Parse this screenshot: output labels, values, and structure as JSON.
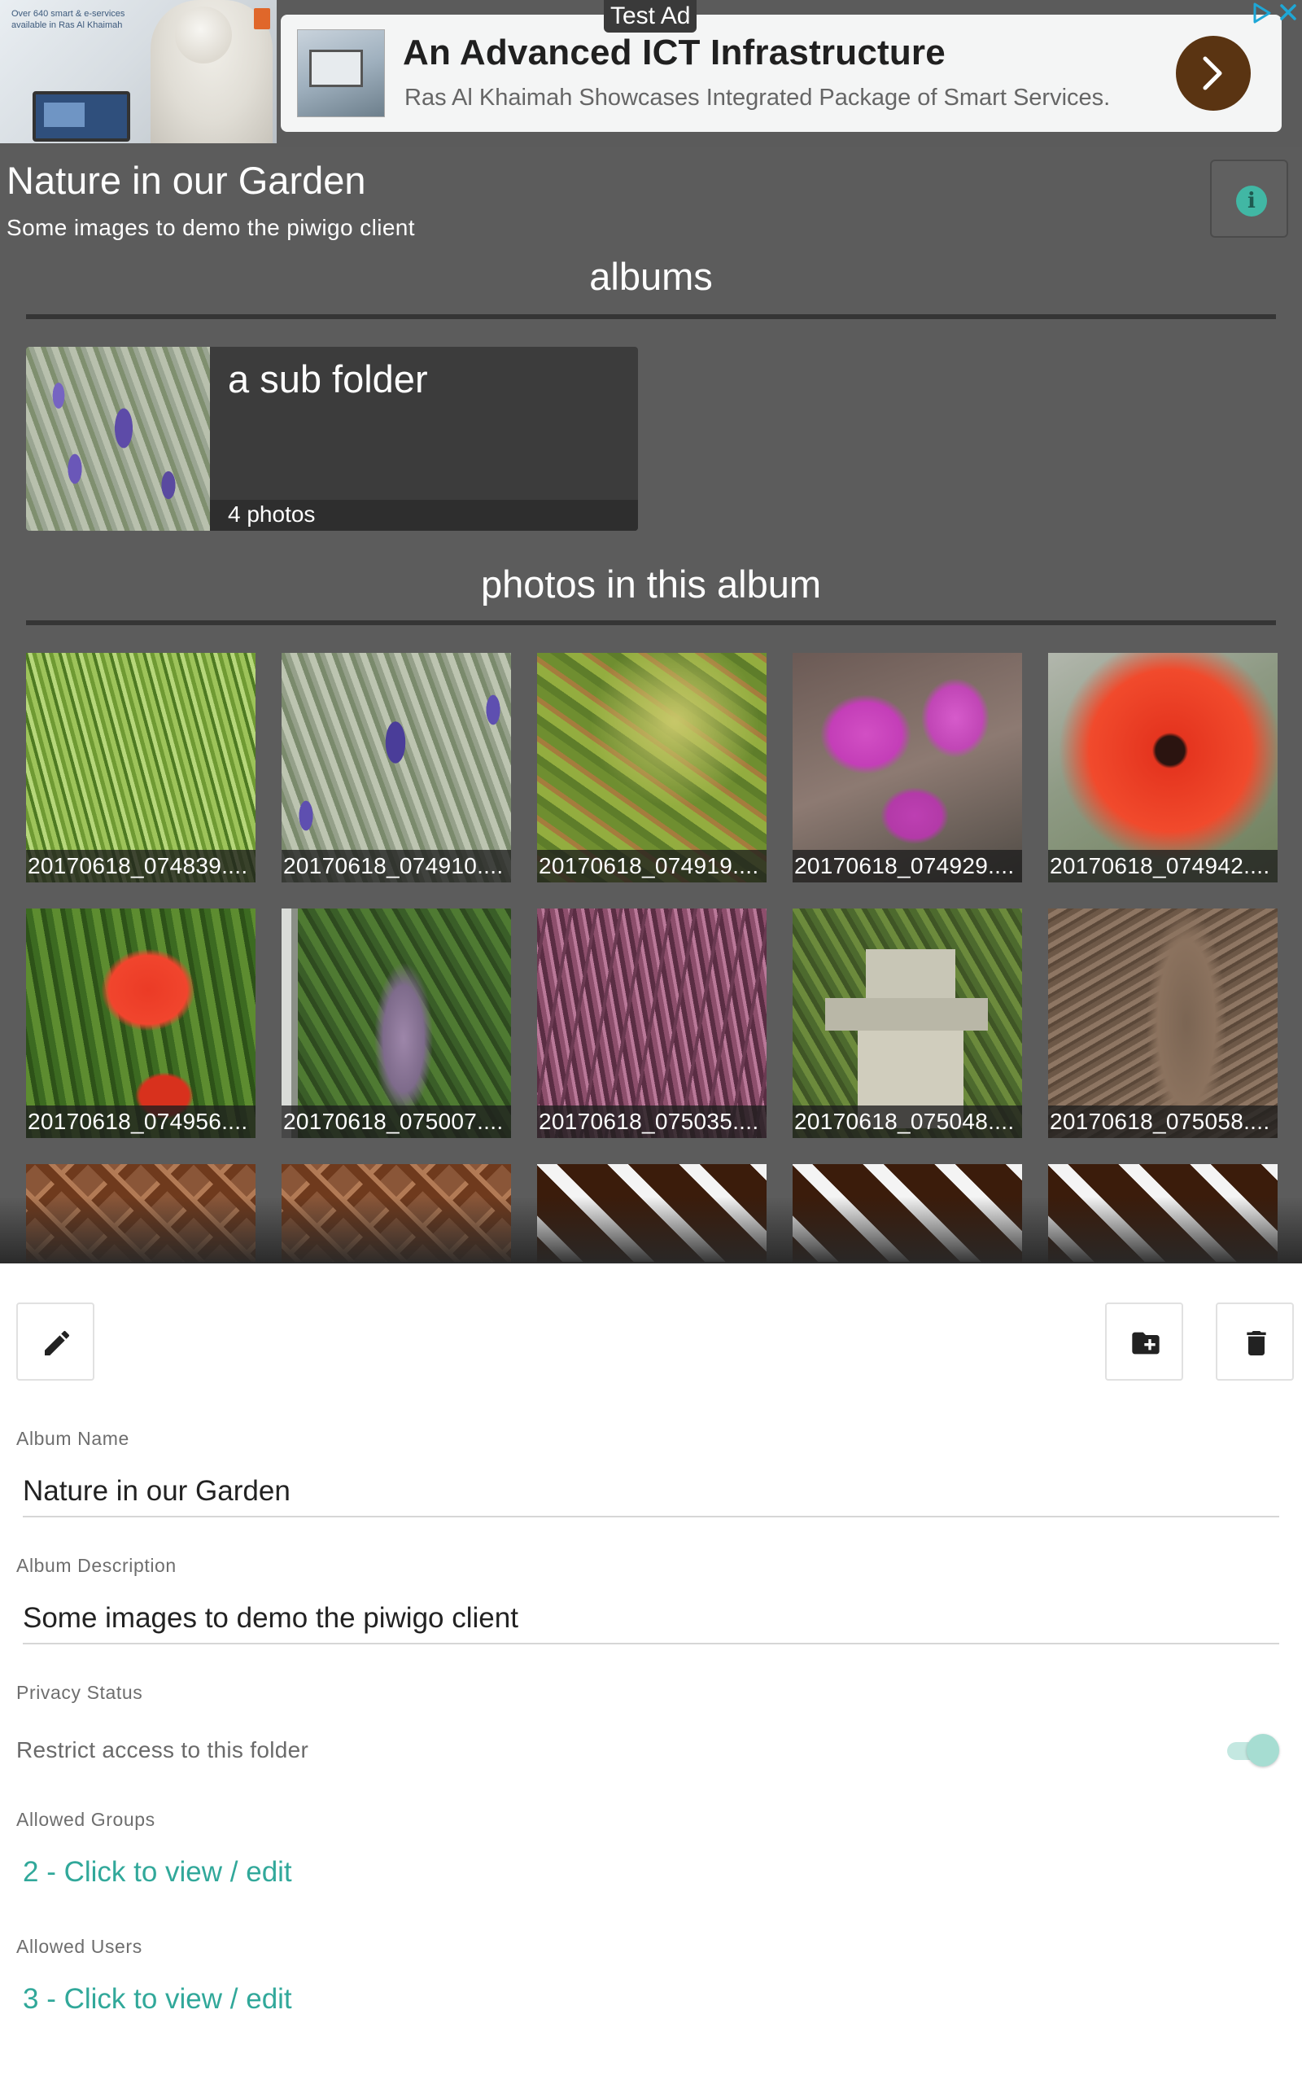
{
  "ad": {
    "label": "Test Ad",
    "photo_text": "Over 640 smart & e-services available in Ras Al Khaimah",
    "headline": "An Advanced ICT Infrastructure",
    "subtext": "Ras Al Khaimah Showcases Integrated Package of Smart Services.",
    "icons": [
      "adchoices-icon",
      "close-icon",
      "chevron-right-icon"
    ]
  },
  "album": {
    "title": "Nature in our Garden",
    "description": "Some images to demo the piwigo client",
    "info_icon": "info-icon",
    "albums_heading": "albums",
    "photos_heading": "photos in this album",
    "subalbums": [
      {
        "name": "a sub folder",
        "count": "4 photos"
      }
    ],
    "photos": [
      {
        "caption": "20170618_074839...."
      },
      {
        "caption": "20170618_074910...."
      },
      {
        "caption": "20170618_074919...."
      },
      {
        "caption": "20170618_074929...."
      },
      {
        "caption": "20170618_074942...."
      },
      {
        "caption": "20170618_074956...."
      },
      {
        "caption": "20170618_075007...."
      },
      {
        "caption": "20170618_075035...."
      },
      {
        "caption": "20170618_075048...."
      },
      {
        "caption": "20170618_075058...."
      }
    ]
  },
  "sheet": {
    "toolbar_icons": [
      "pencil-icon",
      "folder-add-icon",
      "trash-icon"
    ],
    "album_name_label": "Album Name",
    "album_name_value": "Nature in our Garden",
    "album_desc_label": "Album Description",
    "album_desc_value": "Some images to demo the piwigo client",
    "privacy_label": "Privacy Status",
    "privacy_text": "Restrict access to this folder",
    "privacy_restricted": true,
    "groups_label": "Allowed Groups",
    "groups_link": "2 - Click to view / edit",
    "users_label": "Allowed Users",
    "users_link": "3 - Click to view / edit"
  },
  "colors": {
    "album_bg": "#5c5c5c",
    "accent": "#31a89a",
    "ad_button": "#5a3412"
  }
}
